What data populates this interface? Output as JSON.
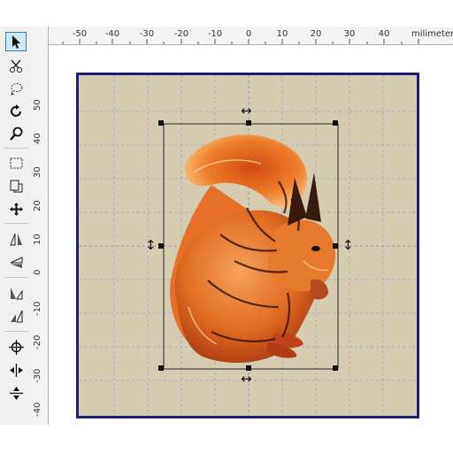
{
  "ruler": {
    "units_label": "milimeters",
    "h_labels": [
      "-50",
      "-40",
      "-30",
      "-20",
      "-10",
      "0",
      "10",
      "20",
      "30",
      "40"
    ],
    "v_labels": [
      "50",
      "40",
      "30",
      "20",
      "10",
      "0",
      "-10",
      "-20",
      "-30",
      "-40",
      "50"
    ]
  },
  "tools": [
    {
      "name": "select-arrow-icon",
      "selected": true
    },
    {
      "name": "reshape-scissors-icon"
    },
    {
      "name": "lasso-select-icon"
    },
    {
      "name": "rotate-icon"
    },
    {
      "name": "zoom-magnifier-icon"
    },
    {
      "name": "rectangle-select-icon"
    },
    {
      "name": "crop-icon"
    },
    {
      "name": "move-icon"
    },
    {
      "name": "mirror-horizontal-icon"
    },
    {
      "name": "mirror-vertical-icon"
    },
    {
      "name": "align-left-icon"
    },
    {
      "name": "align-right-icon"
    },
    {
      "name": "center-crosshair-icon"
    },
    {
      "name": "center-horizontal-icon"
    },
    {
      "name": "center-vertical-icon"
    }
  ],
  "canvas": {
    "hoop_color": "#1a1f7a",
    "fabric_color": "#d6cdb1",
    "grid_color": "#9aa6c9",
    "design": "squirrel embroidery"
  }
}
